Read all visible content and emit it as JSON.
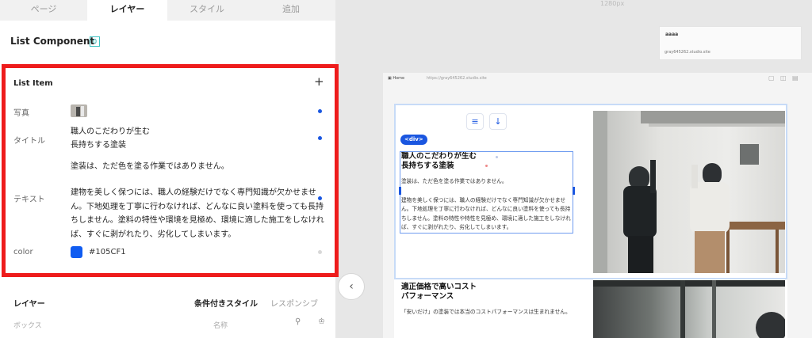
{
  "tabs": [
    {
      "label": "ページ"
    },
    {
      "label": "レイヤー"
    },
    {
      "label": "スタイル"
    },
    {
      "label": "追加"
    }
  ],
  "component": {
    "title": "List Component",
    "badge": "0"
  },
  "list_item": {
    "title": "List Item",
    "add_icon": "plus-icon",
    "props": {
      "photo_label": "写真",
      "title_label": "タイトル",
      "title_lines": [
        "職人のこだわりが生む",
        "長持ちする塗装"
      ],
      "text_label": "テキスト",
      "text_p1": "塗装は、ただ色を塗る作業ではありません。",
      "text_p2": "建物を美しく保つには、職人の経験だけでなく専門知識が欠かせません。下地処理を丁寧に行わなければ、どんなに良い塗料を使っても長持ちしません。塗料の特性や環境を見極め、環境に適した施工をしなければ、すぐに剥がれたり、劣化してしまいます。",
      "color_label": "color",
      "color_value": "#105CF1"
    }
  },
  "layers": {
    "title": "レイヤー",
    "conditional_style": "条件付きスタイル",
    "responsive": "レスポンシブ",
    "col_box": "ボックス",
    "col_name": "名称"
  },
  "canvas": {
    "width_label": "1280px",
    "site_card": {
      "name": "aaaa",
      "url": "gray645262.studio.site"
    },
    "page_name": "Home",
    "page_url": "https://gray645262.studio.site",
    "div_tag": "<div>",
    "item1": {
      "title_lines": [
        "職人のこだわりが生む",
        "長持ちする塗装"
      ],
      "text1": "塗装は、ただ色を塗る作業ではありません。",
      "text2": "建物を美しく保つには、職人の経験だけでなく専門知識が欠かせません。下地処理を丁寧に行わなければ、どんなに良い塗料を使っても長持ちしません。塗料の特性や特性を見極め、環境に適した施工をしなければ、すぐに剥がれたり、劣化してしまいます。"
    },
    "item2": {
      "title_lines": [
        "適正価格で高いコスト",
        "パフォーマンス"
      ],
      "text": "「安いだけ」の塗装では本当のコストパフォーマンスは生まれません。"
    }
  },
  "colors": {
    "accent": "#1a56e0",
    "highlight": "#ee1c1c",
    "swatch": "#105CF1"
  },
  "icons": {
    "collapse": "chevron-left-icon",
    "align": "align-left-icon",
    "down": "arrow-down-icon"
  }
}
